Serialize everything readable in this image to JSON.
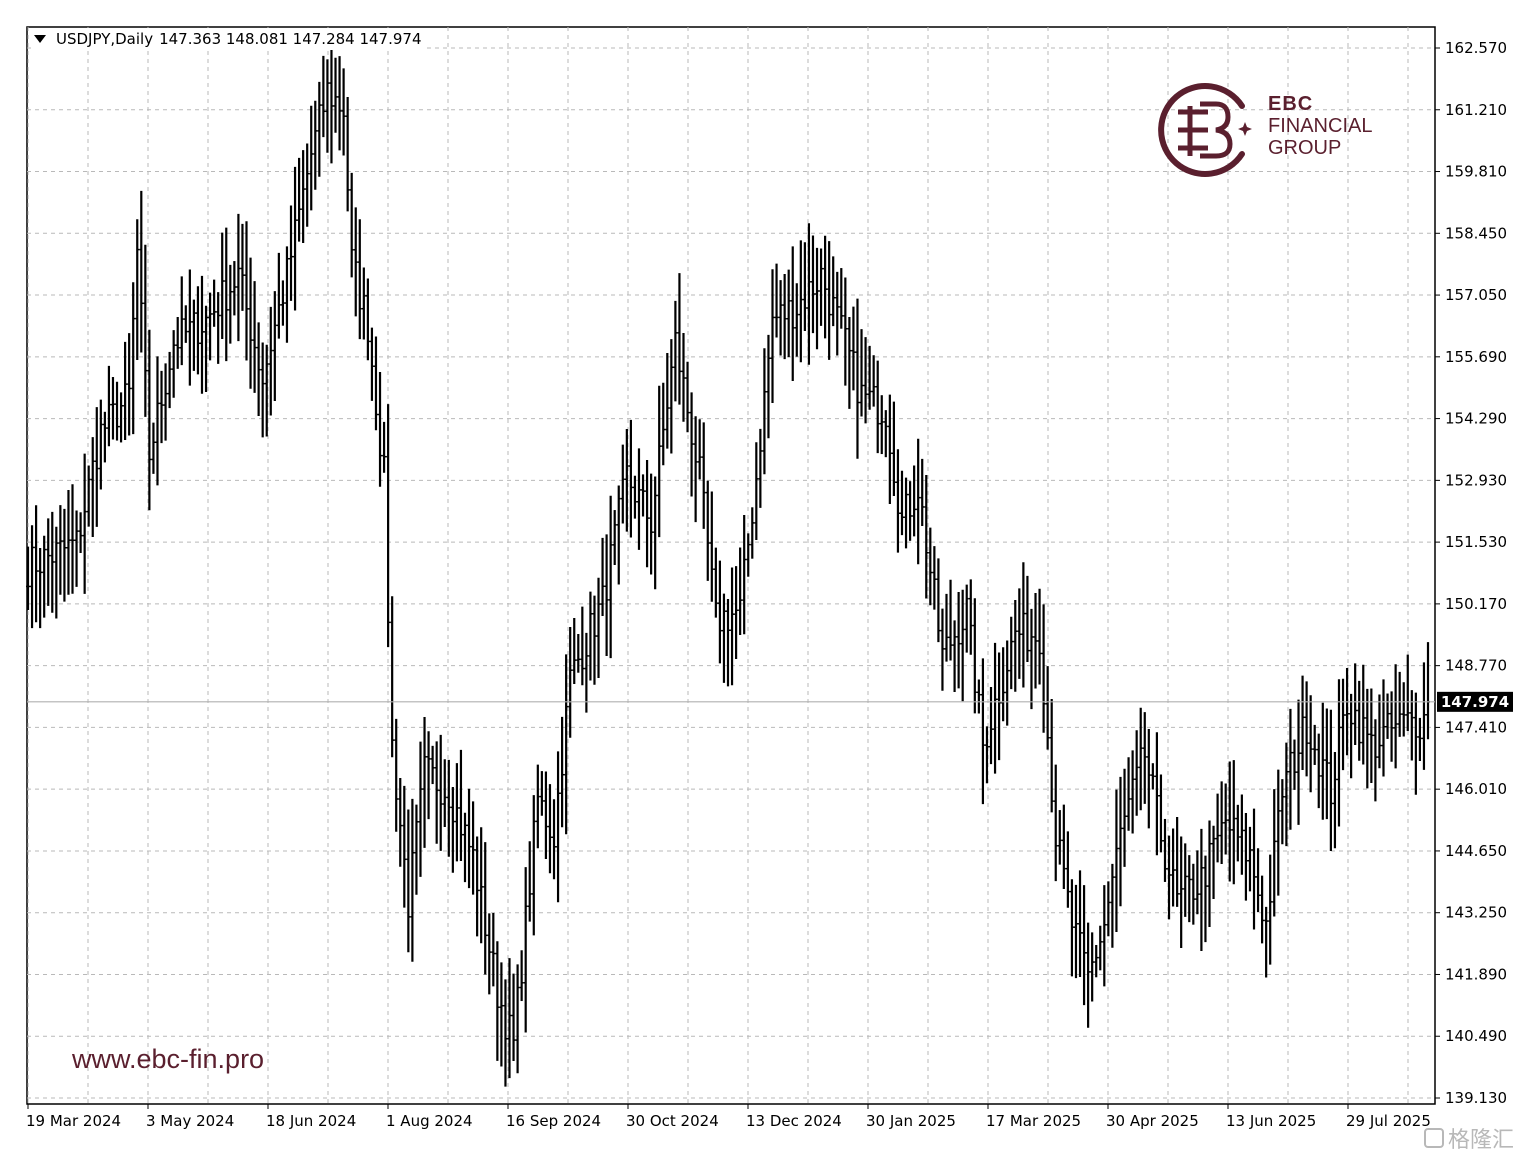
{
  "header": {
    "symbol": "USDJPY,Daily",
    "ohlc": "147.363 148.081 147.284 147.974"
  },
  "logo": {
    "brand": "EBC",
    "line2": "FINANCIAL",
    "line3": "GROUP",
    "color": "#5a1f2e"
  },
  "website": "www.ebc-fin.pro",
  "watermark": "格隆汇",
  "chart_data": {
    "type": "bar",
    "style": "OHLC price bars",
    "symbol": "USDJPY",
    "timeframe": "Daily",
    "current_price": "147.974",
    "ylim": [
      139.13,
      162.57
    ],
    "y_ticks": [
      "162.570",
      "161.210",
      "159.810",
      "158.450",
      "157.050",
      "155.690",
      "154.290",
      "152.930",
      "151.530",
      "150.170",
      "148.770",
      "147.410",
      "146.010",
      "144.650",
      "143.250",
      "141.890",
      "140.490",
      "139.130"
    ],
    "x_ticks": [
      "19 Mar 2024",
      "3 May 2024",
      "18 Jun 2024",
      "1 Aug 2024",
      "16 Sep 2024",
      "30 Oct 2024",
      "13 Dec 2024",
      "30 Jan 2025",
      "17 Mar 2025",
      "30 Apr 2025",
      "13 Jun 2025",
      "29 Jul 2025"
    ],
    "grid": true,
    "anchors": [
      [
        0,
        151.0
      ],
      [
        12,
        151.5
      ],
      [
        18,
        154.0
      ],
      [
        25,
        154.8
      ],
      [
        27,
        158.0
      ],
      [
        30,
        153.5
      ],
      [
        36,
        156.0
      ],
      [
        44,
        156.5
      ],
      [
        52,
        157.5
      ],
      [
        58,
        155.2
      ],
      [
        64,
        157.5
      ],
      [
        70,
        160.2
      ],
      [
        74,
        161.6
      ],
      [
        78,
        161.2
      ],
      [
        80,
        157.8
      ],
      [
        84,
        156.4
      ],
      [
        88,
        153.0
      ],
      [
        90,
        147.0
      ],
      [
        94,
        143.5
      ],
      [
        98,
        146.4
      ],
      [
        104,
        146.0
      ],
      [
        110,
        144.5
      ],
      [
        116,
        141.5
      ],
      [
        120,
        140.3
      ],
      [
        126,
        145.8
      ],
      [
        130,
        145.0
      ],
      [
        134,
        148.5
      ],
      [
        142,
        150.2
      ],
      [
        148,
        153.0
      ],
      [
        154,
        152.0
      ],
      [
        160,
        156.0
      ],
      [
        166,
        153.0
      ],
      [
        170,
        149.8
      ],
      [
        176,
        150.0
      ],
      [
        180,
        153.0
      ],
      [
        184,
        156.5
      ],
      [
        190,
        156.8
      ],
      [
        196,
        157.5
      ],
      [
        200,
        156.5
      ],
      [
        206,
        154.8
      ],
      [
        212,
        154.5
      ],
      [
        216,
        152.0
      ],
      [
        220,
        152.8
      ],
      [
        226,
        149.0
      ],
      [
        232,
        150.0
      ],
      [
        236,
        147.0
      ],
      [
        244,
        149.5
      ],
      [
        250,
        149.5
      ],
      [
        254,
        145.0
      ],
      [
        258,
        143.0
      ],
      [
        262,
        141.8
      ],
      [
        266,
        143.0
      ],
      [
        270,
        145.0
      ],
      [
        276,
        146.8
      ],
      [
        280,
        145.0
      ],
      [
        284,
        143.5
      ],
      [
        290,
        144.0
      ],
      [
        296,
        145.3
      ],
      [
        302,
        144.5
      ],
      [
        306,
        143.0
      ],
      [
        310,
        146.0
      ],
      [
        316,
        147.5
      ],
      [
        322,
        146.0
      ],
      [
        326,
        148.0
      ],
      [
        332,
        147.0
      ],
      [
        336,
        147.3
      ],
      [
        340,
        147.5
      ],
      [
        346,
        147.6
      ]
    ]
  }
}
